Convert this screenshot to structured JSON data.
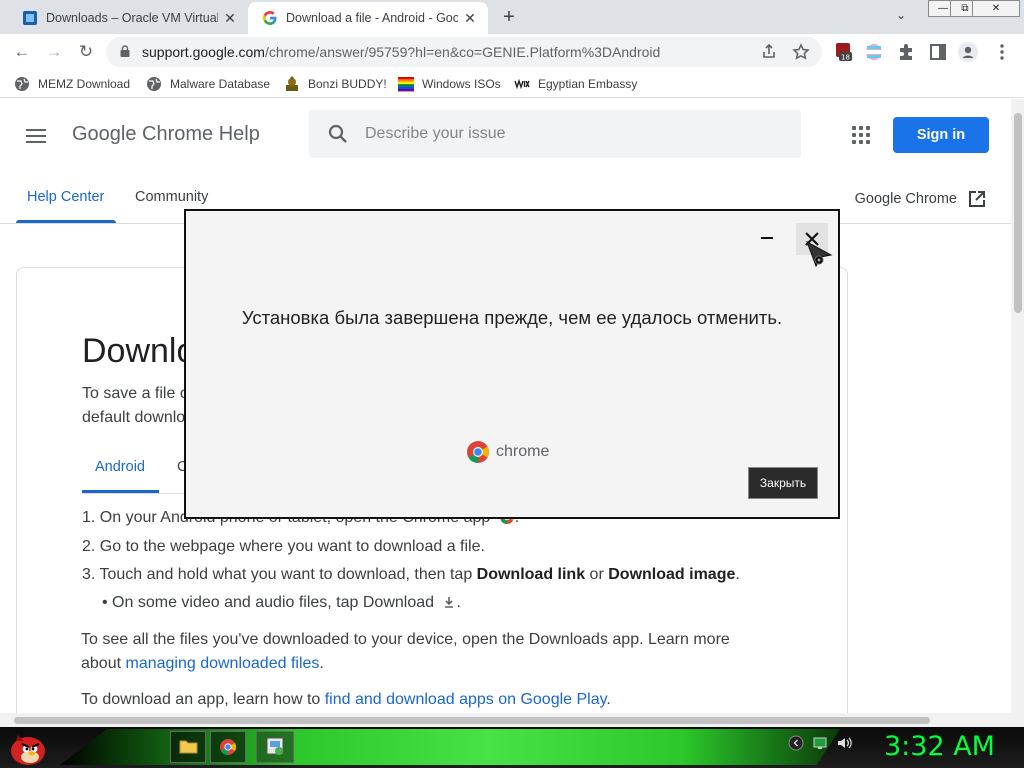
{
  "browser": {
    "tabs": [
      {
        "title": "Downloads – Oracle VM VirtualBox",
        "close": "✕"
      },
      {
        "title": "Download a file - Android - Google Chrome Help",
        "close": "✕"
      }
    ],
    "new_tab": "+",
    "tab_search": "⌄",
    "window": {
      "minimize": "—",
      "restore": "⧉",
      "close": "✕"
    },
    "nav": {
      "back": "←",
      "forward": "→",
      "reload": "↻"
    },
    "url_host": "support.google.com",
    "url_rest": "/chrome/answer/95759?hl=en&co=GENIE.Platform%3DAndroid",
    "ext_badge": "18",
    "bookmarks": [
      "MEMZ Download",
      "Malware Database",
      "Bonzi BUDDY!",
      "Windows ISOs",
      "Egyptian Embassy"
    ]
  },
  "page": {
    "site_title": "Google Chrome Help",
    "search_placeholder": "Describe your issue",
    "sign_in": "Sign in",
    "tabs": {
      "help_center": "Help Center",
      "community": "Community"
    },
    "product": "Google Chrome",
    "article": {
      "title": "Download a file",
      "intro_line1": "To save a file o",
      "intro_line2": "default downlo",
      "platform_active": "Android",
      "platform_other": "C",
      "step1_tail_a": "On your Android phone or tablet, open the Chrome app",
      "step2": "Go to the webpage where you want to download a file.",
      "step3_a": "Touch and hold what you want to download, then tap ",
      "step3_b": "Download link",
      "step3_c": " or ",
      "step3_d": "Download image",
      "step3_e": ".",
      "bullet": "On some video and audio files, tap Download",
      "para1_line1": "To see all the files you've downloaded to your device, open the Downloads app. Learn more",
      "para1_about": "about ",
      "para1_link": "managing downloaded files",
      "para2_a": "To download an app, learn how to ",
      "para2_link": "find and download apps on Google Play",
      "para2_b": "."
    }
  },
  "dialog": {
    "message": "Установка была завершена прежде, чем ее удалось отменить.",
    "logo_text": "chrome",
    "button": "Закрыть"
  },
  "taskbar": {
    "clock": "3:32 AM"
  },
  "colors": {
    "accent": "#1a73e8",
    "link": "#1967d2",
    "clock": "#00ff3c"
  }
}
